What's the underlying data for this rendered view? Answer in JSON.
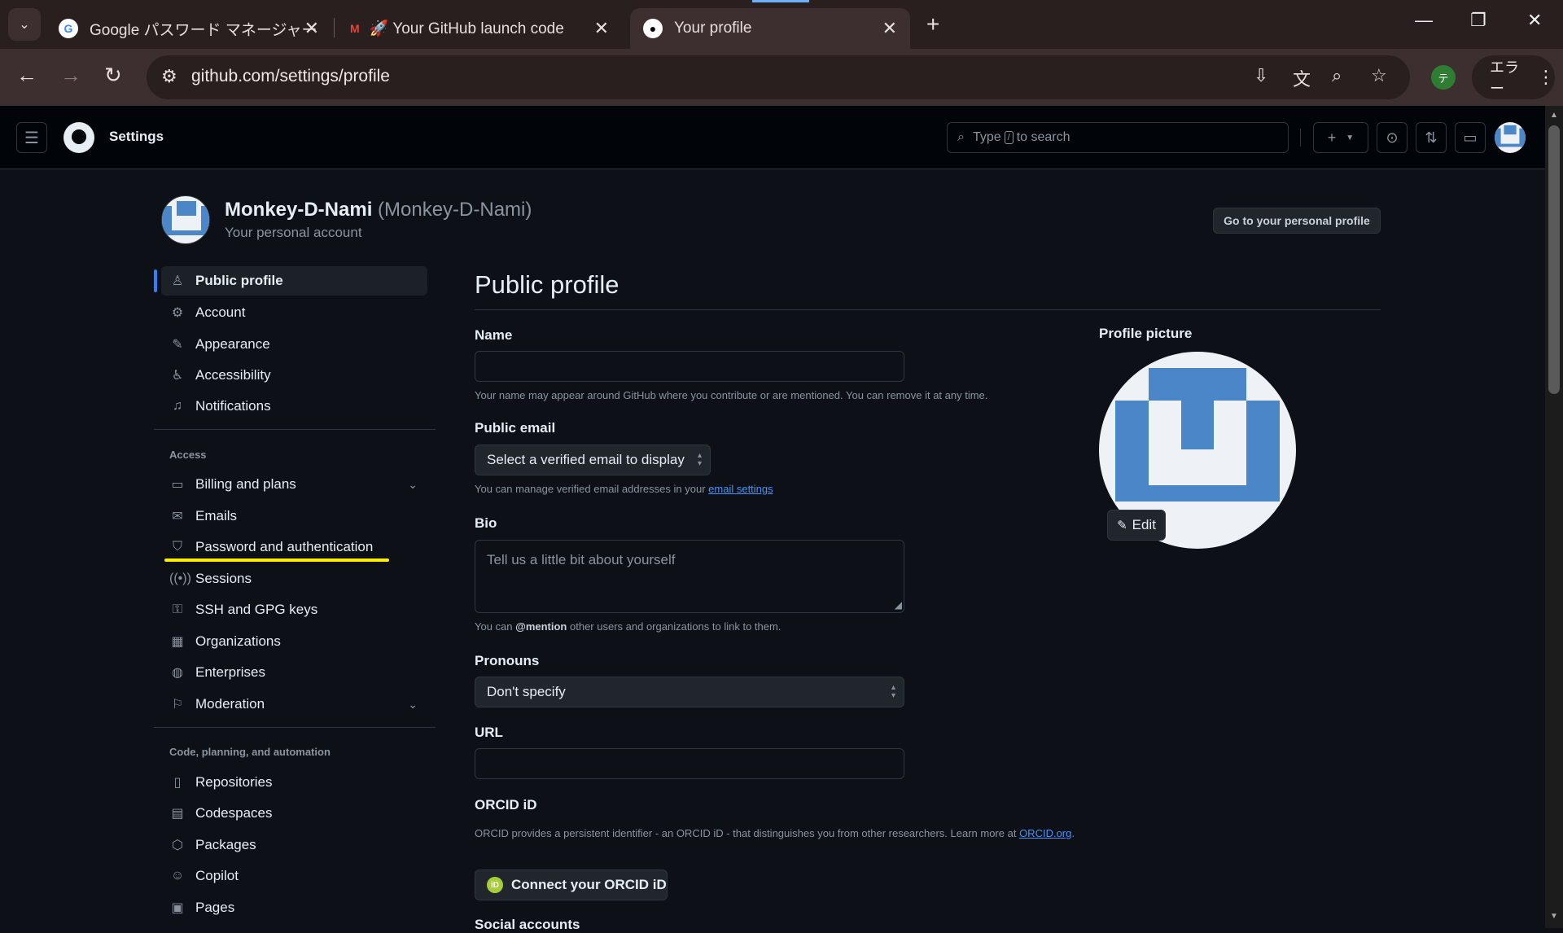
{
  "browser": {
    "tabs": [
      {
        "title": "Google パスワード マネージャー"
      },
      {
        "title": "🚀 Your GitHub launch code - i"
      },
      {
        "title": "Your profile"
      }
    ],
    "url": "github.com/settings/profile",
    "profile_badge": "テ",
    "error_label": "エラー"
  },
  "header": {
    "title": "Settings",
    "search_prefix": "Type",
    "search_key": "/",
    "search_suffix": "to search"
  },
  "account": {
    "display_name": "Monkey-D-Nami",
    "login": "(Monkey-D-Nami)",
    "subtitle": "Your personal account",
    "goto_button": "Go to your personal profile"
  },
  "sidebar": {
    "items_top": [
      {
        "label": "Public profile",
        "icon": "person-icon"
      },
      {
        "label": "Account",
        "icon": "gear-icon"
      },
      {
        "label": "Appearance",
        "icon": "paintbrush-icon"
      },
      {
        "label": "Accessibility",
        "icon": "accessibility-icon"
      },
      {
        "label": "Notifications",
        "icon": "bell-icon"
      }
    ],
    "group_access": "Access",
    "items_access": [
      {
        "label": "Billing and plans",
        "icon": "credit-card-icon"
      },
      {
        "label": "Emails",
        "icon": "mail-icon"
      },
      {
        "label": "Password and authentication",
        "icon": "shield-lock-icon"
      },
      {
        "label": "Sessions",
        "icon": "broadcast-icon"
      },
      {
        "label": "SSH and GPG keys",
        "icon": "key-icon"
      },
      {
        "label": "Organizations",
        "icon": "organization-icon"
      },
      {
        "label": "Enterprises",
        "icon": "globe-icon"
      },
      {
        "label": "Moderation",
        "icon": "report-icon"
      }
    ],
    "group_code": "Code, planning, and automation",
    "items_code": [
      {
        "label": "Repositories",
        "icon": "repo-icon"
      },
      {
        "label": "Codespaces",
        "icon": "codespaces-icon"
      },
      {
        "label": "Packages",
        "icon": "package-icon"
      },
      {
        "label": "Copilot",
        "icon": "copilot-icon"
      },
      {
        "label": "Pages",
        "icon": "browser-icon"
      }
    ]
  },
  "main": {
    "title": "Public profile",
    "name_label": "Name",
    "name_value": "",
    "name_hint": "Your name may appear around GitHub where you contribute or are mentioned. You can remove it at any time.",
    "email_label": "Public email",
    "email_select": "Select a verified email to display",
    "email_hint_prefix": "You can manage verified email addresses in your",
    "email_hint_link": "email settings",
    "bio_label": "Bio",
    "bio_placeholder": "Tell us a little bit about yourself",
    "bio_hint_prefix": "You can",
    "bio_hint_bold": "@mention",
    "bio_hint_suffix": "other users and organizations to link to them.",
    "pronouns_label": "Pronouns",
    "pronouns_select": "Don't specify",
    "url_label": "URL",
    "url_value": "",
    "orcid_label": "ORCID iD",
    "orcid_hint": "ORCID provides a persistent identifier - an ORCID iD - that distinguishes you from other researchers. Learn more at",
    "orcid_link": "ORCID.org",
    "orcid_link_end": ".",
    "orcid_badge": "iD",
    "orcid_button": "Connect your ORCID iD",
    "social_label": "Social accounts"
  },
  "profile_picture": {
    "label": "Profile picture",
    "edit_button": "Edit"
  },
  "colors": {
    "background": "#0d1117",
    "header_bg": "#010409",
    "accent": "#2f81f7",
    "highlight": "#ffee00",
    "identicon": "#4a86c8"
  }
}
